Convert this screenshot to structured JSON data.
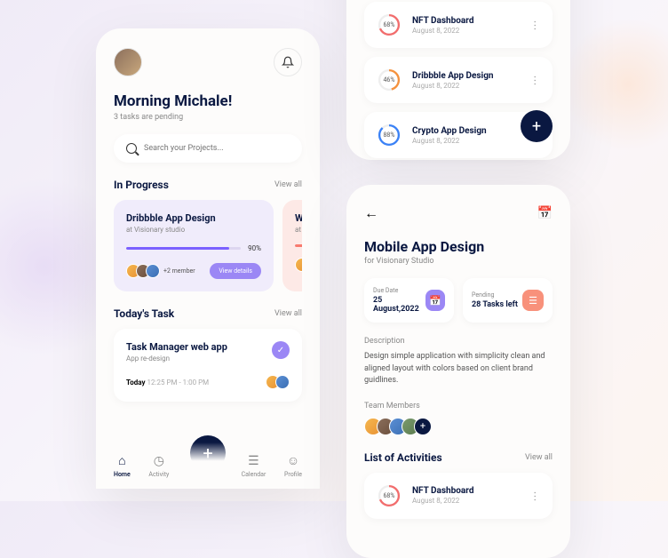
{
  "screen1": {
    "greeting": "Morning Michale!",
    "pending": "3 tasks are pending",
    "search_placeholder": "Search your Projects...",
    "sections": {
      "in_progress": {
        "title": "In Progress",
        "viewall": "View all"
      },
      "todays_task": {
        "title": "Today's Task",
        "viewall": "View all"
      }
    },
    "cards": [
      {
        "title": "Dribbble App Design",
        "sub": "at Visionary studio",
        "pct": "90%",
        "progress": 90,
        "member_text": "+2 member",
        "btn": "View details"
      },
      {
        "title": "Web A",
        "sub": "at RonD",
        "pct": "",
        "progress": 60
      }
    ],
    "task": {
      "title": "Task Manager web app",
      "sub": "App re-design",
      "today": "Today ",
      "time": "12:25 PM - 1:00 PM"
    },
    "nav": {
      "home": "Home",
      "activity": "Activity",
      "calendar": "Calendar",
      "profile": "Profile"
    }
  },
  "screen2": {
    "activities": [
      {
        "title": "NFT Dashboard",
        "date": "August 8, 2022",
        "pct": "68%",
        "color": "#f26d6d",
        "progress": 68
      },
      {
        "title": "Dribbble App Design",
        "date": "August 8, 2022",
        "pct": "46%",
        "color": "#f5923e",
        "progress": 46
      },
      {
        "title": "Crypto App Design",
        "date": "August 8, 2022",
        "pct": "88%",
        "color": "#3b82f6",
        "progress": 88
      }
    ]
  },
  "screen3": {
    "title": "Mobile App Design",
    "sub": "for Visionary Studio",
    "due": {
      "label": "Due Date",
      "value": "25 August,2022"
    },
    "pending": {
      "label": "Pending",
      "value": "28 Tasks left"
    },
    "desc_label": "Description",
    "desc": "Design simple application with simplicity clean and aligned layout with colors based on client brand guidlines.",
    "team_label": "Team Members",
    "list_label": "List of Activities",
    "viewall": "View all",
    "activity": {
      "title": "NFT Dashboard",
      "date": "August 8, 2022",
      "pct": "68%",
      "color": "#f26d6d"
    }
  }
}
